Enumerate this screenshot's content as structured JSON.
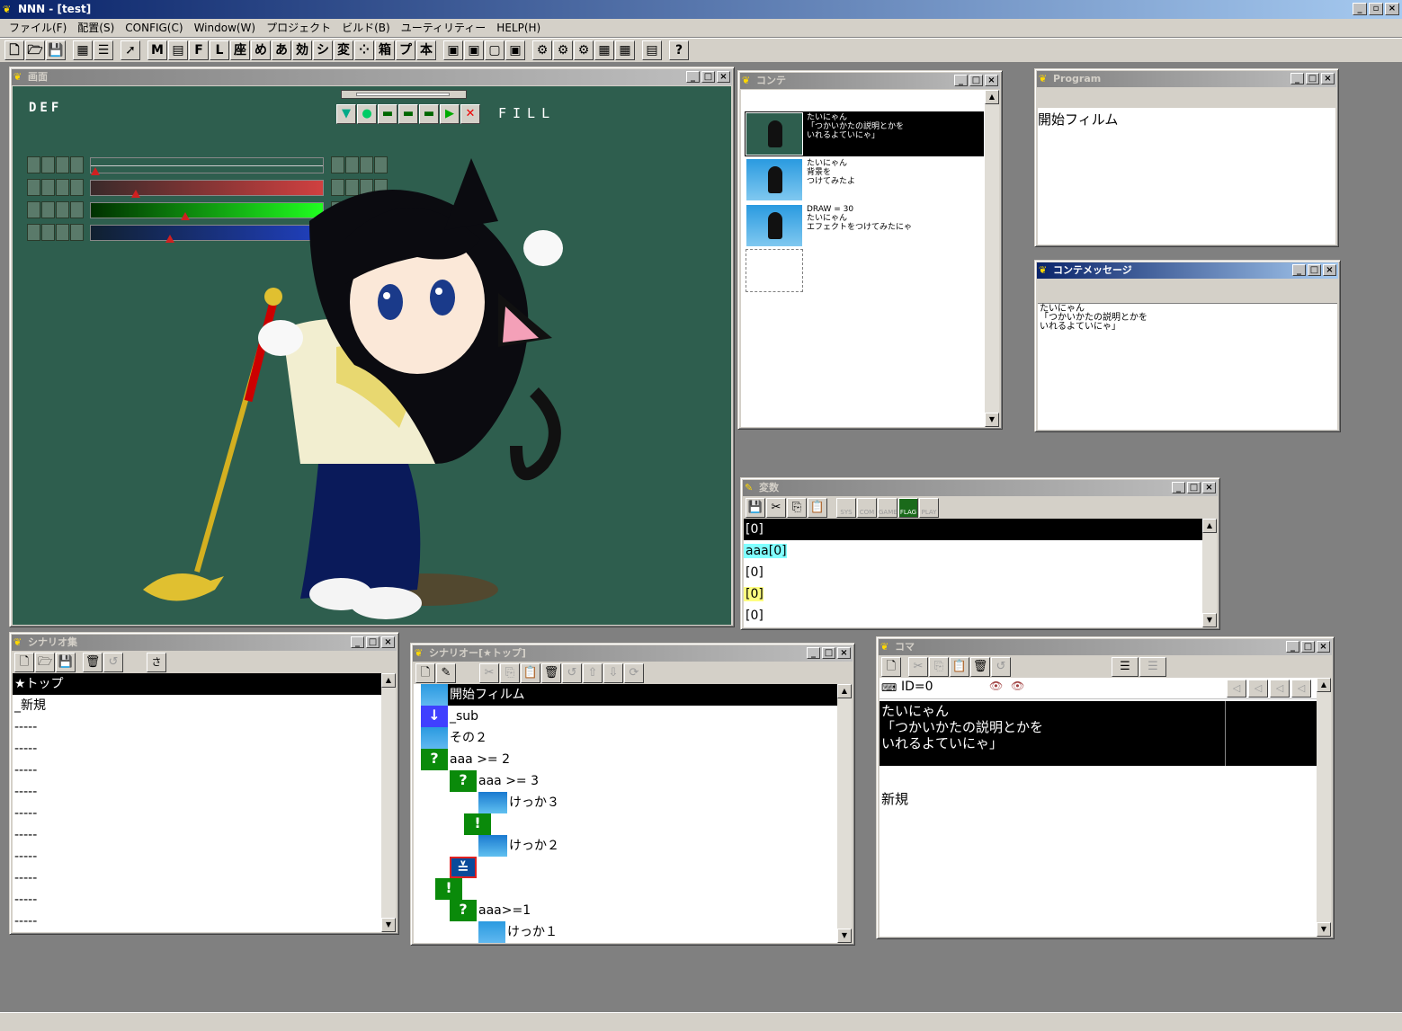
{
  "app": {
    "title": "NNN - [test]"
  },
  "menu": [
    "ファイル(F)",
    "配置(S)",
    "CONFIG(C)",
    "Window(W)",
    "プロジェクト",
    "ビルド(B)",
    "ユーティリティー",
    "HELP(H)"
  ],
  "toolbar": [
    "",
    "",
    "",
    "",
    "",
    "",
    "M",
    "",
    "F",
    "L",
    "座",
    "め",
    "",
    "効",
    "シ",
    "変",
    "",
    "箱",
    "プ",
    "本",
    "",
    "",
    "",
    "",
    "",
    "",
    "",
    "",
    "",
    "",
    "?"
  ],
  "screen": {
    "title": "画面",
    "def_label": "DEF",
    "fill_label": "FILL",
    "bg": "#2e5e4e",
    "sliders": [
      0.0,
      0.18,
      0.4,
      0.33
    ]
  },
  "conte": {
    "title": "コンテ",
    "items": [
      {
        "text": "たいにゃん\n「つかいかたの説明とかを\nいれるよていにゃ」",
        "selected": true
      },
      {
        "text": "たいにゃん\n背景を\nつけてみたよ",
        "selected": false
      },
      {
        "text": "DRAW = 30\nたいにゃん\nエフェクトをつけてみたにゃ",
        "selected": false
      }
    ]
  },
  "program": {
    "title": "Program",
    "text": "開始フィルム"
  },
  "conte_message": {
    "title": "コンテメッセージ",
    "text": "たいにゃん\n「つかいかたの説明とかを\nいれるよていにゃ」"
  },
  "variables": {
    "title": "変数",
    "toolbar_labels": [
      "SYS",
      "COM",
      "GAME",
      "FLAG",
      "PLAY"
    ],
    "rows": [
      {
        "text": "[0]",
        "selected": true,
        "highlight": ""
      },
      {
        "text": "aaa[0]",
        "selected": false,
        "highlight": "#80ffff"
      },
      {
        "text": "[0]",
        "selected": false,
        "highlight": ""
      },
      {
        "text": "[0]",
        "selected": false,
        "highlight": "#ffff80"
      },
      {
        "text": "[0]",
        "selected": false,
        "highlight": ""
      }
    ]
  },
  "scenario_list": {
    "title": "シナリオ集",
    "search_label": "さ",
    "items": [
      {
        "text": "★トップ",
        "selected": true
      },
      {
        "text": "_新規",
        "selected": false
      },
      {
        "text": "-----",
        "selected": false
      },
      {
        "text": "-----",
        "selected": false
      },
      {
        "text": "-----",
        "selected": false
      },
      {
        "text": "-----",
        "selected": false
      },
      {
        "text": "-----",
        "selected": false
      },
      {
        "text": "-----",
        "selected": false
      },
      {
        "text": "-----",
        "selected": false
      },
      {
        "text": "-----",
        "selected": false
      },
      {
        "text": "-----",
        "selected": false
      },
      {
        "text": "-----",
        "selected": false
      }
    ]
  },
  "scenario": {
    "title": "シナリオー[★トップ]",
    "items": [
      {
        "text": "開始フィルム",
        "indent": 0,
        "icon": "film",
        "selected": true
      },
      {
        "text": "_sub",
        "indent": 0,
        "icon": "sub",
        "selected": false
      },
      {
        "text": "その２",
        "indent": 0,
        "icon": "film",
        "selected": false
      },
      {
        "text": "aaa >= 2",
        "indent": 0,
        "icon": "if",
        "selected": false
      },
      {
        "text": "aaa >= 3",
        "indent": 1,
        "icon": "if",
        "selected": false
      },
      {
        "text": "けっか３",
        "indent": 2,
        "icon": "sky",
        "selected": false
      },
      {
        "text": "",
        "indent": 1.5,
        "icon": "else",
        "selected": false
      },
      {
        "text": "けっか２",
        "indent": 2,
        "icon": "sky",
        "selected": false
      },
      {
        "text": "",
        "indent": 1,
        "icon": "jump",
        "selected": false
      },
      {
        "text": "",
        "indent": 0.5,
        "icon": "else",
        "selected": false
      },
      {
        "text": "aaa>=1",
        "indent": 1,
        "icon": "if",
        "selected": false
      },
      {
        "text": "けっか１",
        "indent": 2,
        "icon": "film",
        "selected": false
      }
    ]
  },
  "koma": {
    "title": "コマ",
    "id_label": "ID=0",
    "message": "たいにゃん\n「つかいかたの説明とかを\nいれるよていにゃ」",
    "new_label": "新規"
  }
}
